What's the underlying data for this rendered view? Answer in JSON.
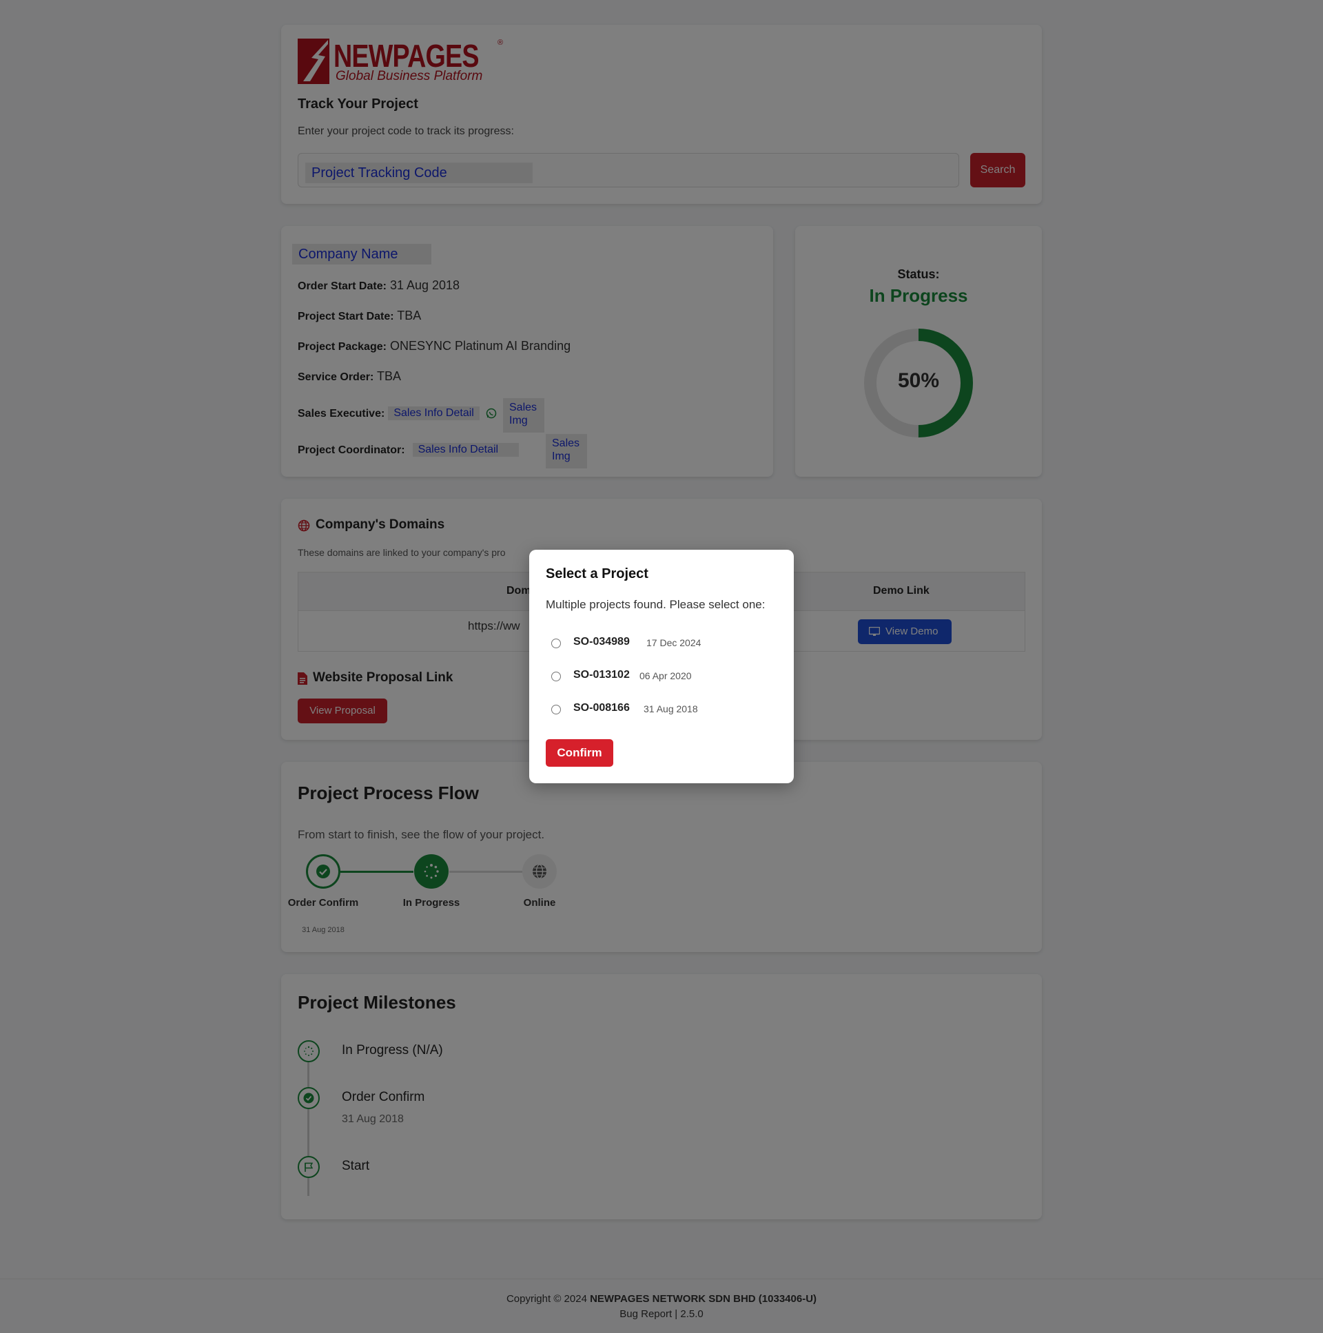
{
  "brand": {
    "name": "NEWPAGES",
    "registered": "®",
    "tagline": "Global Business Platform",
    "color": "#b3121e"
  },
  "track": {
    "title": "Track Your Project",
    "description": "Enter your project code to track its progress:",
    "input_placeholder": "Project Tracking Code",
    "search_label": "Search"
  },
  "info": {
    "company_name": "Company Name",
    "order_start_label": "Order Start Date:",
    "order_start_value": "31 Aug 2018",
    "project_start_label": "Project Start Date:",
    "project_start_value": "TBA",
    "package_label": "Project Package:",
    "package_value": "ONESYNC Platinum AI Branding",
    "service_order_label": "Service Order:",
    "service_order_value": "TBA",
    "sales_exec_label": "Sales Executive:",
    "sales_exec_link": "Sales Info Detail",
    "sales_exec_img": "Sales Img",
    "coordinator_label": "Project Coordinator:",
    "coordinator_link": "Sales Info Detail",
    "coordinator_img": "Sales Img"
  },
  "status": {
    "label": "Status:",
    "value": "In Progress",
    "progress_percent": 50,
    "progress_text": "50%",
    "color": "#1b8a3c"
  },
  "domains": {
    "title": "Company's Domains",
    "subtitle": "These domains are linked to your company's pro",
    "col_domain": "Dom",
    "col_demo": "Demo Link",
    "row_domain": "https://ww",
    "view_demo_label": "View Demo",
    "proposal_title": "Website Proposal Link",
    "view_proposal_label": "View Proposal"
  },
  "flow": {
    "title": "Project Process Flow",
    "subtitle": "From start to finish, see the flow of your project.",
    "steps": [
      {
        "label": "Order Confirm",
        "date": "31 Aug 2018",
        "state": "done"
      },
      {
        "label": "In Progress",
        "date": "",
        "state": "current"
      },
      {
        "label": "Online",
        "date": "",
        "state": "pending"
      }
    ]
  },
  "milestones": {
    "title": "Project Milestones",
    "items": [
      {
        "title": "In Progress   (N/A)",
        "date": ""
      },
      {
        "title": "Order Confirm",
        "date": "31 Aug 2018"
      },
      {
        "title": "Start",
        "date": ""
      }
    ]
  },
  "footer": {
    "copyright_prefix": "Copyright © 2024 ",
    "company": "NEWPAGES NETWORK SDN BHD (1033406-U)",
    "bug_report": "Bug Report | 2.5.0"
  },
  "modal": {
    "title": "Select a Project",
    "subtitle": "Multiple projects found. Please select one:",
    "options": [
      {
        "code": "SO-034989",
        "date": "17 Dec 2024"
      },
      {
        "code": "SO-013102",
        "date": "06 Apr 2020"
      },
      {
        "code": "SO-008166",
        "date": "31 Aug 2018"
      }
    ],
    "confirm_label": "Confirm"
  }
}
